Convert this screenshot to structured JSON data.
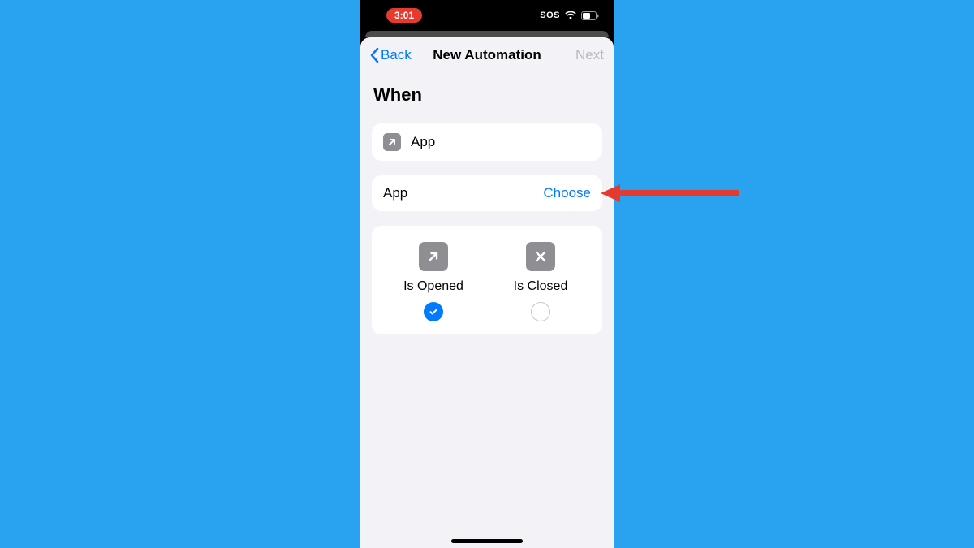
{
  "colors": {
    "background": "#29a3ef",
    "accent": "#007aff",
    "time_pill": "#e53b2e",
    "annotation": "#e53b2e"
  },
  "status_bar": {
    "time": "3:01",
    "sos": "SOS"
  },
  "nav": {
    "back_label": "Back",
    "title": "New Automation",
    "next_label": "Next"
  },
  "section_heading": "When",
  "trigger_card": {
    "label": "App"
  },
  "app_row": {
    "label": "App",
    "action": "Choose"
  },
  "state_options": {
    "opened": {
      "label": "Is Opened",
      "selected": true
    },
    "closed": {
      "label": "Is Closed",
      "selected": false
    }
  }
}
